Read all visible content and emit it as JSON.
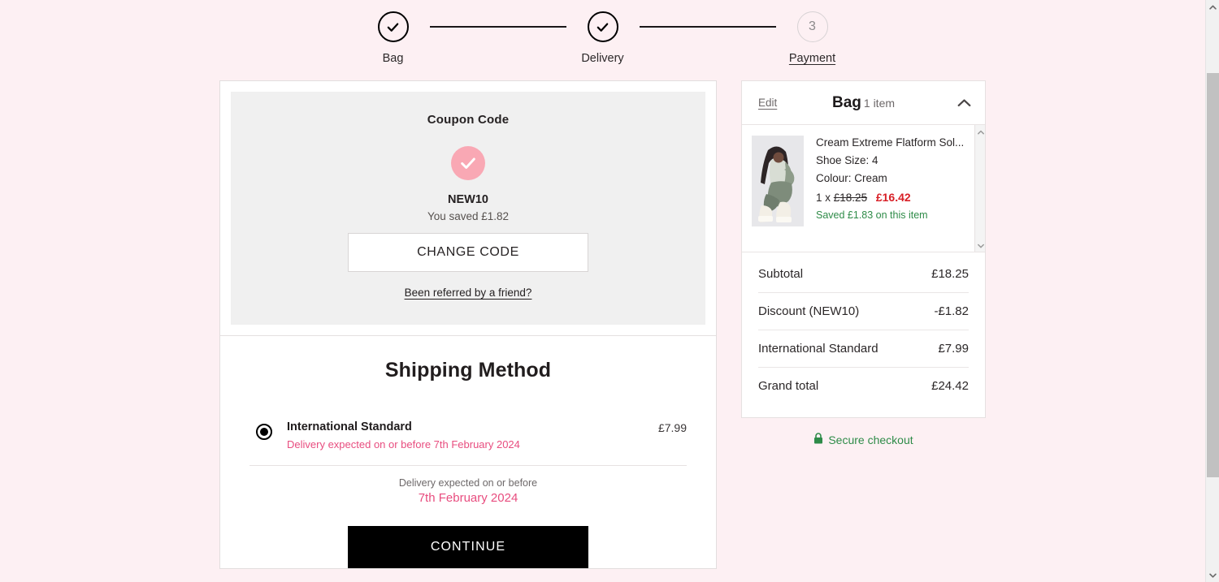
{
  "theme": {
    "page_bg": "#fdf0f3",
    "accent_pink": "#e84d7f",
    "coupon_tick_bg": "#f9a8b4",
    "sale_red": "#d81f26",
    "success_green": "#2e8b48",
    "panel_gray": "#f0f0f0"
  },
  "stepper": {
    "steps": [
      {
        "label": "Bag",
        "state": "done",
        "marker": "check-icon"
      },
      {
        "label": "Delivery",
        "state": "done",
        "marker": "check-icon"
      },
      {
        "label": "Payment",
        "state": "current",
        "marker": "3"
      }
    ]
  },
  "coupon": {
    "title": "Coupon Code",
    "tick_icon": "check-icon",
    "code": "NEW10",
    "saved_text": "You saved £1.82",
    "change_button": "CHANGE CODE",
    "referral_link": "Been referred by a friend?"
  },
  "shipping": {
    "title": "Shipping Method",
    "options": [
      {
        "name": "International Standard",
        "eta": "Delivery expected on or before 7th February 2024",
        "price": "£7.99",
        "selected": true
      }
    ],
    "eta_label": "Delivery expected on or before",
    "eta_date": "7th February 2024",
    "continue_button": "CONTINUE"
  },
  "bag": {
    "edit_label": "Edit",
    "heading": "Bag",
    "item_count": "1 item",
    "collapse_icon": "chevron-up-icon",
    "items": [
      {
        "thumbnail_alt": "model wearing cream platform boots",
        "title": "Cream Extreme Flatform Sol...",
        "size_label": "Shoe Size: 4",
        "colour_label": "Colour: Cream",
        "quantity_prefix": "1 x",
        "was_price": "£18.25",
        "now_price": "£16.42",
        "saved_text": "Saved £1.83 on this item"
      }
    ],
    "totals": [
      {
        "label": "Subtotal",
        "value": "£18.25"
      },
      {
        "label": "Discount (NEW10)",
        "value": "-£1.82"
      },
      {
        "label": "International Standard",
        "value": "£7.99"
      },
      {
        "label": "Grand total",
        "value": "£24.42"
      }
    ],
    "secure_label": "Secure checkout",
    "secure_icon": "lock-icon"
  }
}
